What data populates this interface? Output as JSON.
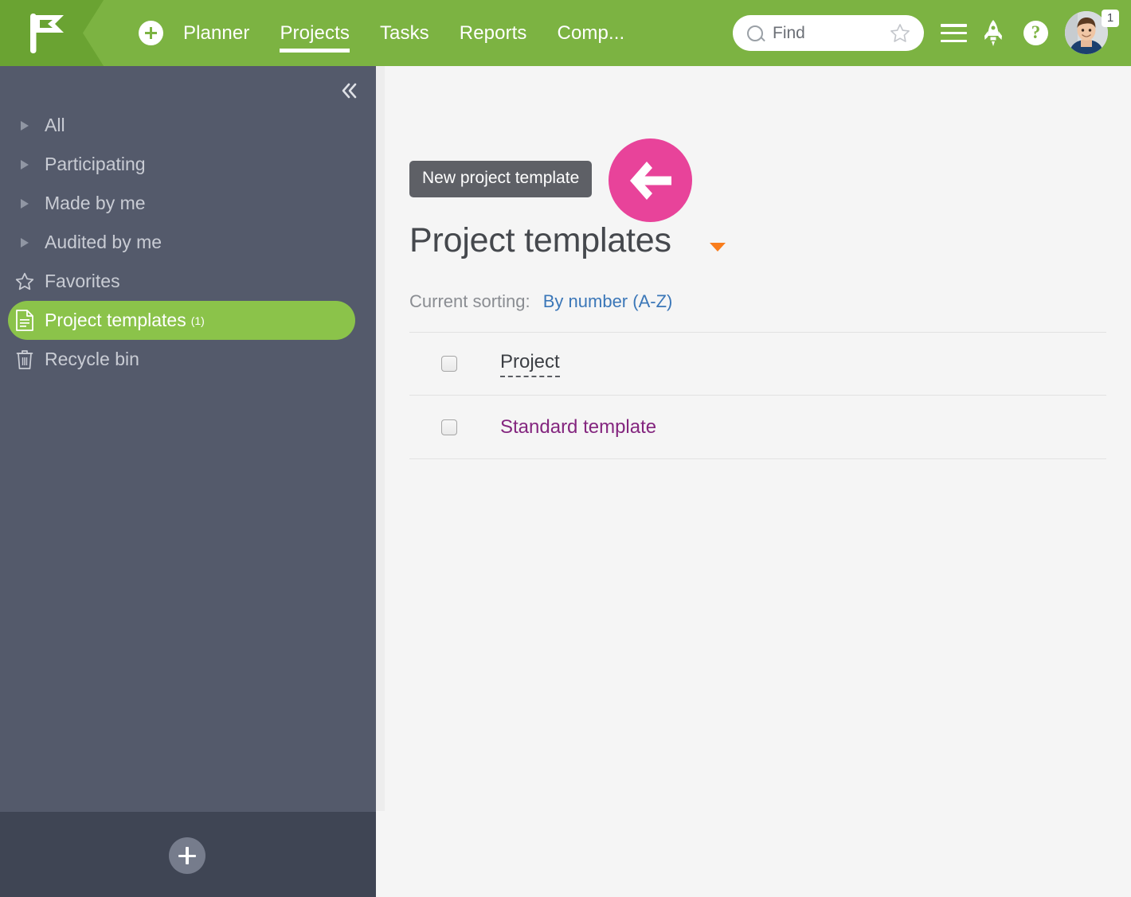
{
  "header": {
    "logo_icon": "flag-logo-icon",
    "add_button_icon": "plus-circle-icon",
    "nav": [
      {
        "label": "Planner",
        "active": false
      },
      {
        "label": "Projects",
        "active": true
      },
      {
        "label": "Tasks",
        "active": false
      },
      {
        "label": "Reports",
        "active": false
      },
      {
        "label": "Comp...",
        "active": false
      }
    ],
    "search": {
      "placeholder": "Find",
      "value": "",
      "search_icon": "magnifier-icon",
      "favorite_icon": "star-outline-icon"
    },
    "menu_icon": "hamburger-menu-icon",
    "rocket_icon": "rocket-icon",
    "help_icon": "question-mark-icon",
    "avatar_icon": "user-avatar",
    "avatar_badge": "1",
    "accent_green": "#7cb342",
    "logo_green": "#6aa332"
  },
  "sidebar": {
    "collapse_icon": "double-chevron-left-icon",
    "items": [
      {
        "label": "All",
        "icon": "triangle-right-icon",
        "selected": false,
        "count": ""
      },
      {
        "label": "Participating",
        "icon": "triangle-right-icon",
        "selected": false,
        "count": ""
      },
      {
        "label": "Made by me",
        "icon": "triangle-right-icon",
        "selected": false,
        "count": ""
      },
      {
        "label": "Audited by me",
        "icon": "triangle-right-icon",
        "selected": false,
        "count": ""
      },
      {
        "label": "Favorites",
        "icon": "star-outline-icon",
        "selected": false,
        "count": ""
      },
      {
        "label": "Project templates",
        "icon": "document-icon",
        "selected": true,
        "count": "(1)"
      },
      {
        "label": "Recycle bin",
        "icon": "trash-icon",
        "selected": false,
        "count": ""
      }
    ],
    "add_button_icon": "plus-icon",
    "background": "#545a6b",
    "footer_background": "#3f4554",
    "selected_background": "#8bc34a"
  },
  "main": {
    "tooltip": {
      "text": "New project template",
      "background": "#5e6066"
    },
    "highlight_arrow": {
      "icon": "arrow-left-icon",
      "color": "#e8439a"
    },
    "title": "Project templates",
    "title_caret_icon": "caret-down-icon",
    "title_caret_color": "#f97d1c",
    "sorting_label": "Current sorting:",
    "sorting_value": "By number (A-Z)",
    "sorting_link_color": "#3b77b8",
    "rows": [
      {
        "text": "Project",
        "style": "header",
        "checkbox_icon": "checkbox-unchecked-icon"
      },
      {
        "text": "Standard template",
        "style": "link",
        "checkbox_icon": "checkbox-unchecked-icon"
      }
    ]
  }
}
